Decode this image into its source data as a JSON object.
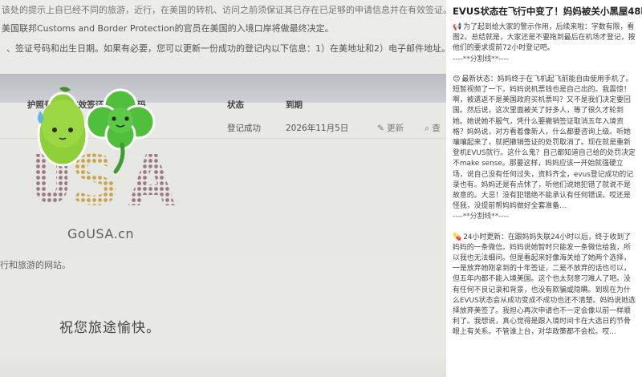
{
  "photo": {
    "line1": "该处的提示上自已经不同的旅游，近行，在美国的转机、访问之前须保证其已存在已足够的申请信息并在有效签证。",
    "line2": "美国联邦Customs and Border Protection的官员在美国的入境口岸将做最终决定。",
    "line3": "、签证号码和出生日期。如果有必要，您可以更新一份成功的登记内以下信息：1）在美地址和2）电子邮件地址。如果",
    "table_headers": [
      "护照号码 / 有效签证的签证号码",
      "状态",
      "到期"
    ],
    "row": {
      "status": "登记成功",
      "expiry": "2026年11月5日",
      "update": "更新",
      "check": "查"
    },
    "hint": "行和旅游的网站。",
    "wish": "祝您旅途愉快。",
    "logo": {
      "word": "USA",
      "site": "GoUSA.cn"
    }
  },
  "article": {
    "title": "EVUS状态在飞行中变了！妈妈被关小黑屋48h😭",
    "p1": "为了起到给大家的警示作用，后续来啦：字数有限，看图2。总结就是，大家还是不要拖到最后在机场才登记，按他们的要求提前72小时登记吧。",
    "divider": "----**分割线**----",
    "p2": "最新状态：妈妈终于在飞机起飞前能自由使用手机了。短暂视频了一下。妈妈说机票钱也是自己出的。我震惊！啊，被遣返不是美国政府买机票吗？又不是我们决定要回国。然后说，这次里面被关了好多人，等了很久才轮到她。她说她不服气，凭什么要撤销签证取消五年入境资格？妈妈说，对方看着像新人，什么都要咨询上级。听她嚷嚷起来了，就把撤销签证的处罚取消了。现在就是重新登机EVUS就行。这什么鬼？自己都知道自己给的处罚决定不make sense。那要这样，妈妈应该一开始就强硬立场，说自己没有任何过失，资料齐全，evus登记成功的记录也有。妈妈还是有点怵了，听他们说她犯错了就说不是故意的。大忌！没有犯错绝不能承认有任何错误。哎还是怪我，没提前帮妈妈做好全套准备...",
    "p3": "24小时更新：在跟妈妈失联24小时以后，终于收到了妈妈的一条微信。妈妈说她智时只能发一条微信给我，所以我也无法细问。但是看起来好像海关给了她两个选择，一是放弃她刚拿到的十年签证，二是不放弃的话也可以，但五年内都不能入境美国。这个也太刻意刁难人了吧。没有任何不良记录和背景，也没有欺骗或隐瞒。到现在为什么EVUS状态会从成功变成不成功也还不清楚。妈妈说她选择放弃美签了。我担心再次申请也不一定会像以前一样顺利了。我想说，真心觉得是跟入境时间卡在大选日的节骨眼上有关系。不管谁上台，对华政策都不会松。哎..."
  }
}
